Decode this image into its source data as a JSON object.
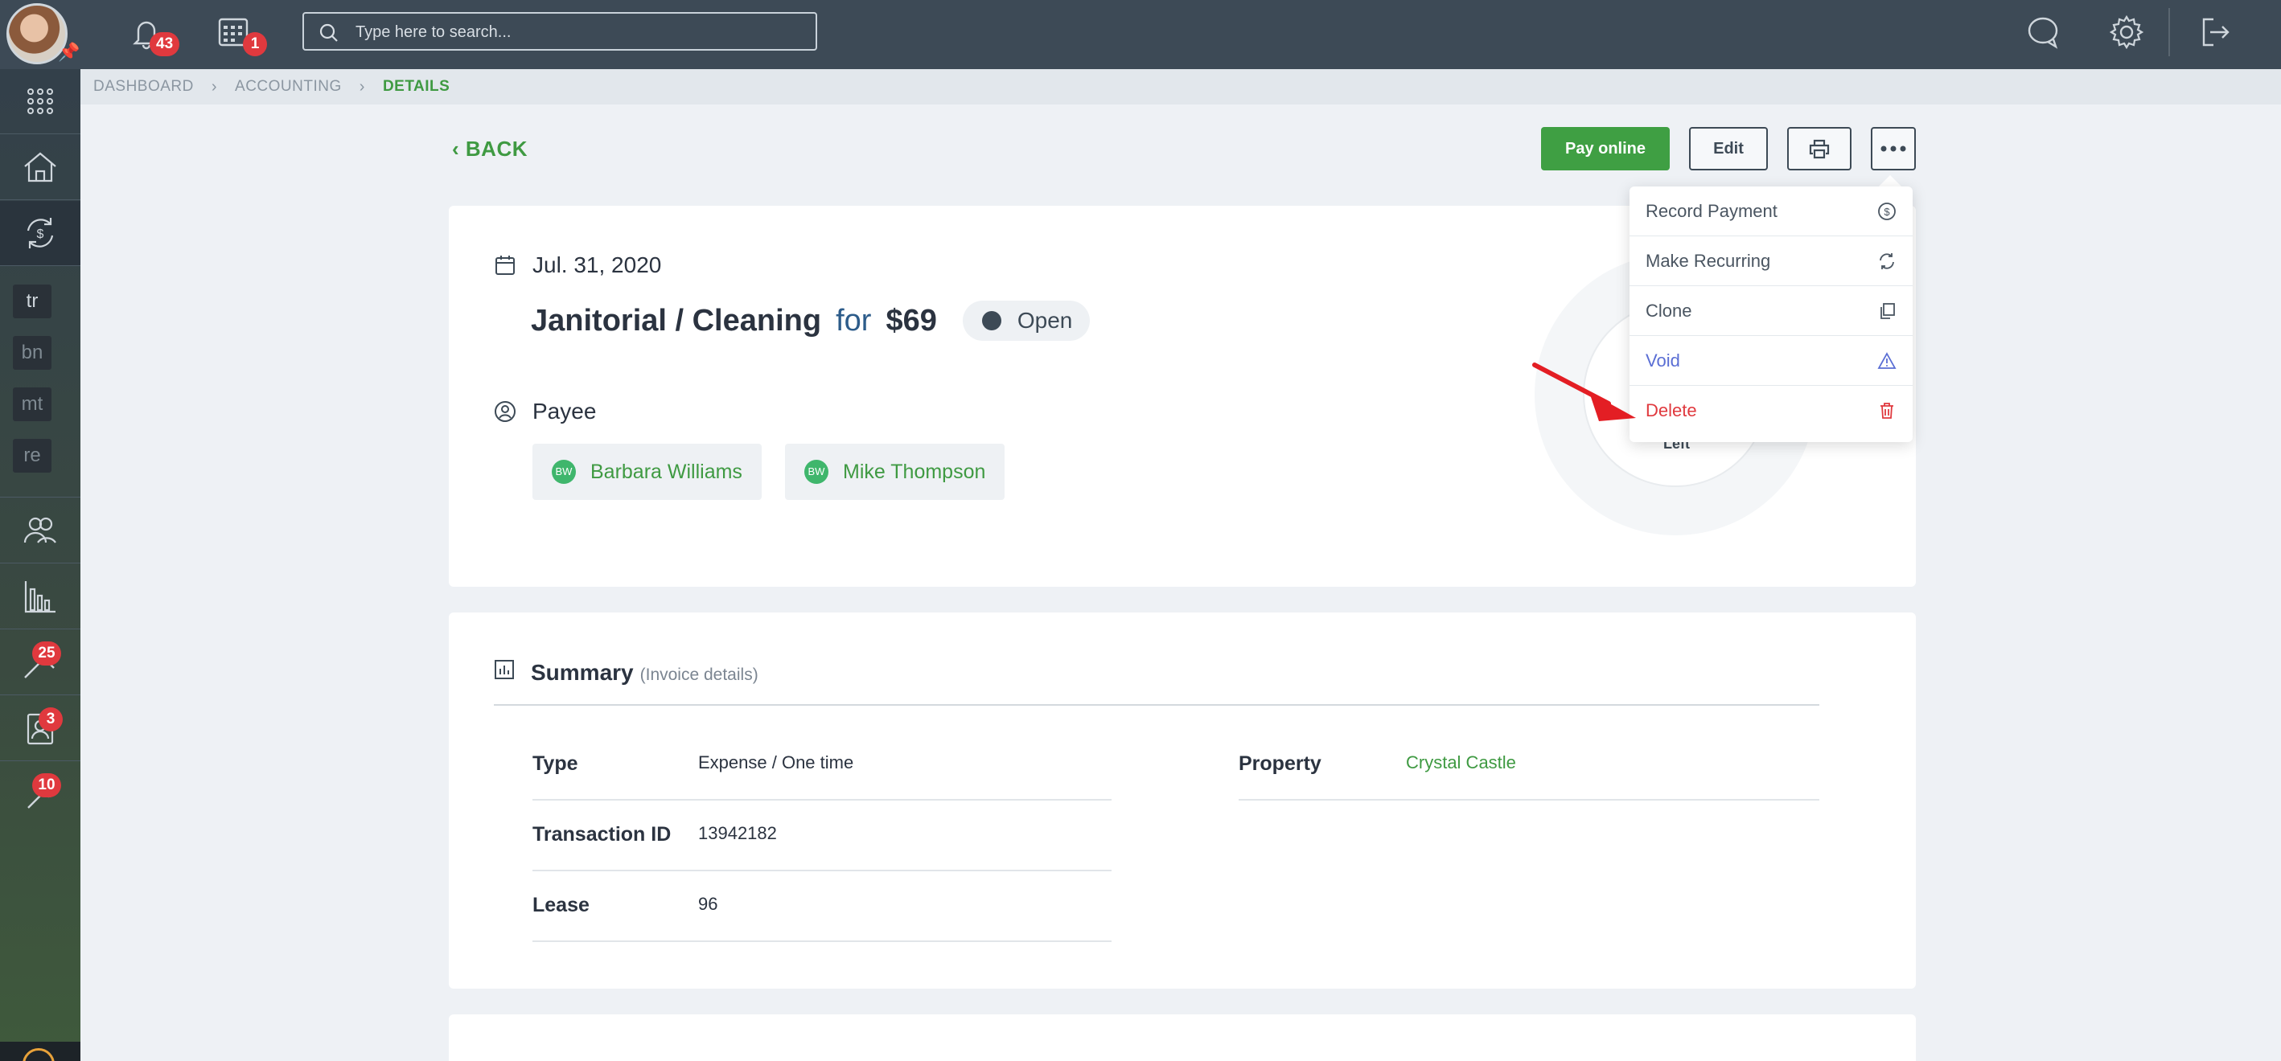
{
  "topbar": {
    "notifications_count": "43",
    "calendar_count": "1",
    "search_placeholder": "Type here to search..."
  },
  "sidebar": {
    "abbreviations": [
      "tr",
      "bn",
      "mt",
      "re"
    ],
    "badges": {
      "maintenance": "25",
      "tenants": "3",
      "tools": "10"
    }
  },
  "breadcrumb": [
    "DASHBOARD",
    "ACCOUNTING",
    "DETAILS"
  ],
  "back_label": "BACK",
  "actions": {
    "pay_online": "Pay online",
    "edit": "Edit"
  },
  "invoice": {
    "date": "Jul. 31, 2020",
    "category": "Janitorial / Cleaning",
    "for_word": "for",
    "amount": "$69",
    "status": "Open",
    "payee_label": "Payee",
    "payees": [
      {
        "initials": "BW",
        "name": "Barbara Williams"
      },
      {
        "initials": "BW",
        "name": "Mike Thompson"
      }
    ],
    "ring_label": "Left"
  },
  "summary": {
    "title": "Summary",
    "subtitle": "(Invoice details)",
    "fields": {
      "type_label": "Type",
      "type_value": "Expense / One time",
      "transaction_label": "Transaction ID",
      "transaction_value": "13942182",
      "lease_label": "Lease",
      "lease_value": "96",
      "property_label": "Property",
      "property_value": "Crystal Castle"
    }
  },
  "dropdown": {
    "items": [
      "Record Payment",
      "Make Recurring",
      "Clone",
      "Void",
      "Delete"
    ]
  },
  "colors": {
    "accent_green": "#3f9f43",
    "danger": "#e0393e",
    "void_blue": "#5a6ed4",
    "topbar": "#3d4a56"
  }
}
